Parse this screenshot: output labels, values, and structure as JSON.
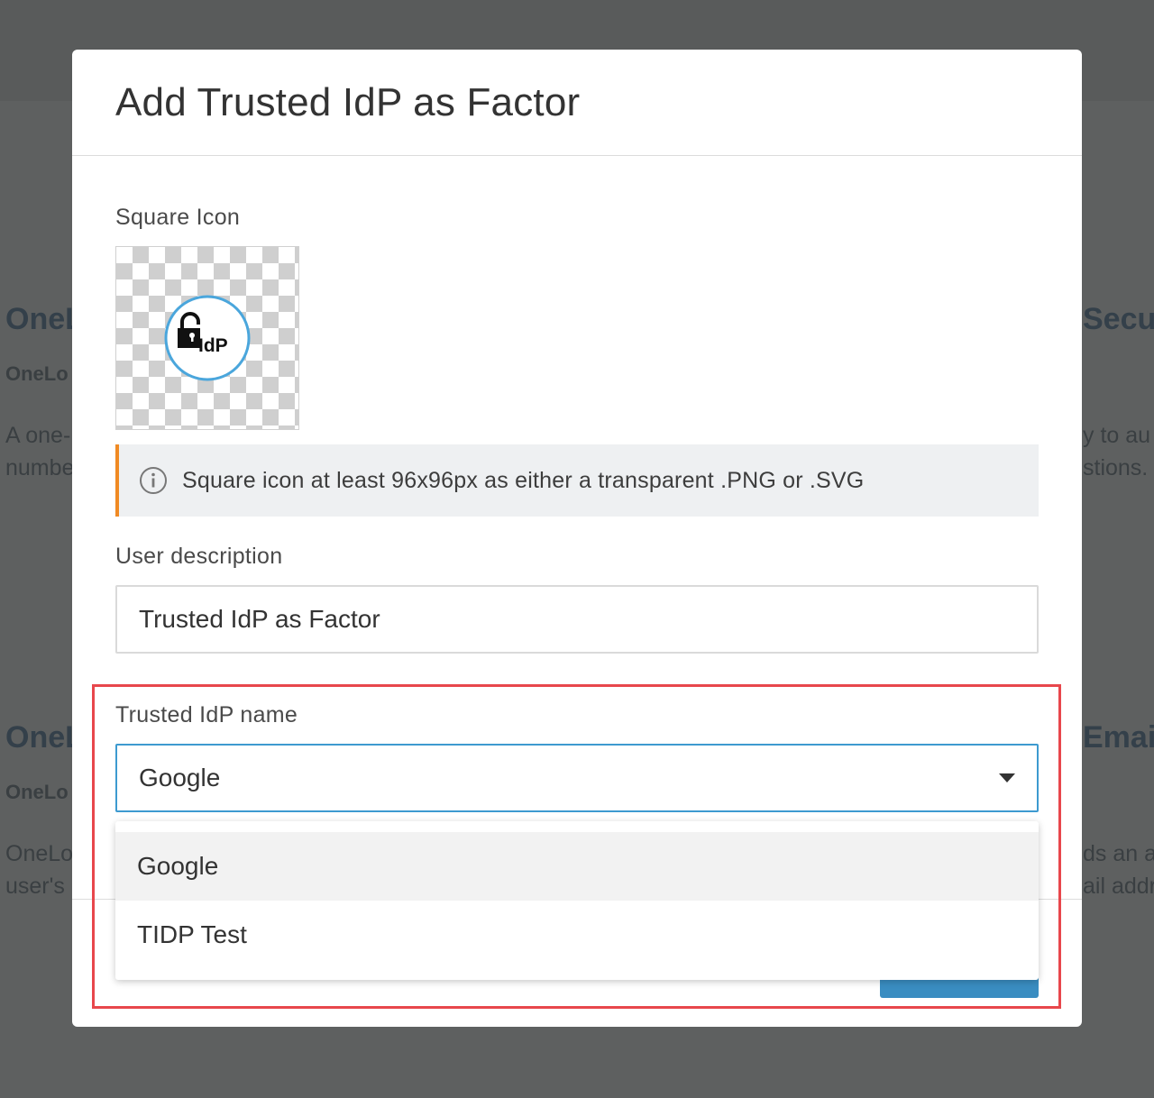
{
  "background": {
    "card_left_1": {
      "title": "OneL",
      "subtitle": "OneLo",
      "desc_line1": "A one-",
      "desc_line2": "numbe"
    },
    "card_right_1": {
      "title": "Secu",
      "desc_line1": "y to au",
      "desc_line2": "stions."
    },
    "card_left_2": {
      "title": "OneL",
      "subtitle": "OneLo",
      "desc_line1": "OneLo",
      "desc_line2": "user's"
    },
    "card_right_2": {
      "title": "Emai",
      "desc_line1": "ds an a",
      "desc_line2": "ail addr"
    }
  },
  "modal": {
    "title": "Add Trusted IdP as Factor",
    "square_icon": {
      "label": "Square Icon",
      "image_alt": "IdP",
      "image_text": "IdP"
    },
    "info": {
      "icon": "info-icon",
      "text": "Square icon at least 96x96px as either a transparent .PNG or .SVG"
    },
    "user_description": {
      "label": "User description",
      "value": "Trusted IdP as Factor"
    },
    "trusted_idp": {
      "label": "Trusted IdP name",
      "selected": "Google",
      "options": [
        "Google",
        "TIDP Test"
      ]
    }
  },
  "colors": {
    "accent": "#3d9ad0",
    "warning_bar": "#f08a24",
    "highlight_frame": "#e8474c",
    "primary_button": "#3a8dc1"
  }
}
